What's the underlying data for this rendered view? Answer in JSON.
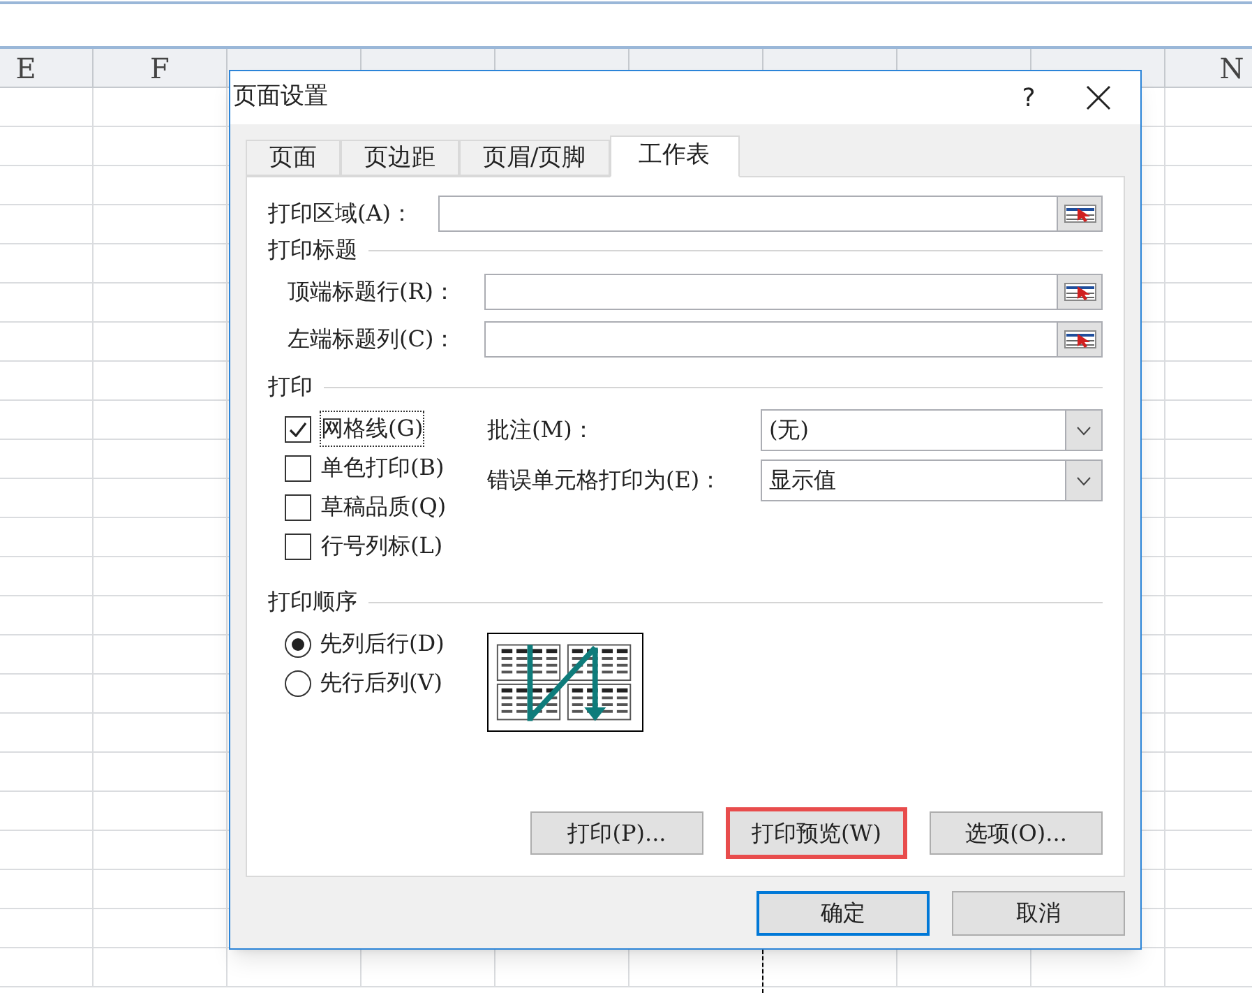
{
  "sheet": {
    "columns": [
      {
        "label": "E"
      },
      {
        "label": "F"
      },
      {
        "label": "N"
      }
    ]
  },
  "dialog": {
    "title": "页面设置",
    "help": "?",
    "tabs": [
      {
        "label": "页面",
        "selected": false
      },
      {
        "label": "页边距",
        "selected": false
      },
      {
        "label": "页眉/页脚",
        "selected": false
      },
      {
        "label": "工作表",
        "selected": true
      }
    ],
    "print_area": {
      "label": "打印区域(A)："
    },
    "titles_section": "打印标题",
    "title_fields": [
      {
        "label": "顶端标题行(R)："
      },
      {
        "label": "左端标题列(C)："
      }
    ],
    "print_section": "打印",
    "checkboxes": [
      {
        "label": "网格线(G)",
        "checked": true,
        "focused": true
      },
      {
        "label": "单色打印(B)",
        "checked": false,
        "focused": false
      },
      {
        "label": "草稿品质(Q)",
        "checked": false,
        "focused": false
      },
      {
        "label": "行号列标(L)",
        "checked": false,
        "focused": false
      }
    ],
    "dropdowns": [
      {
        "label": "批注(M)：",
        "value": "(无)"
      },
      {
        "label": "错误单元格打印为(E)：",
        "value": "显示值"
      }
    ],
    "order_section": "打印顺序",
    "order_options": [
      {
        "label": "先列后行(D)",
        "selected": true
      },
      {
        "label": "先行后列(V)",
        "selected": false
      }
    ],
    "action_buttons": [
      {
        "label": "打印(P)...",
        "highlighted": false
      },
      {
        "label": "打印预览(W)",
        "highlighted": true
      },
      {
        "label": "选项(O)...",
        "highlighted": false
      }
    ],
    "footer_buttons": [
      {
        "label": "确定",
        "default": true
      },
      {
        "label": "取消",
        "default": false
      }
    ]
  }
}
